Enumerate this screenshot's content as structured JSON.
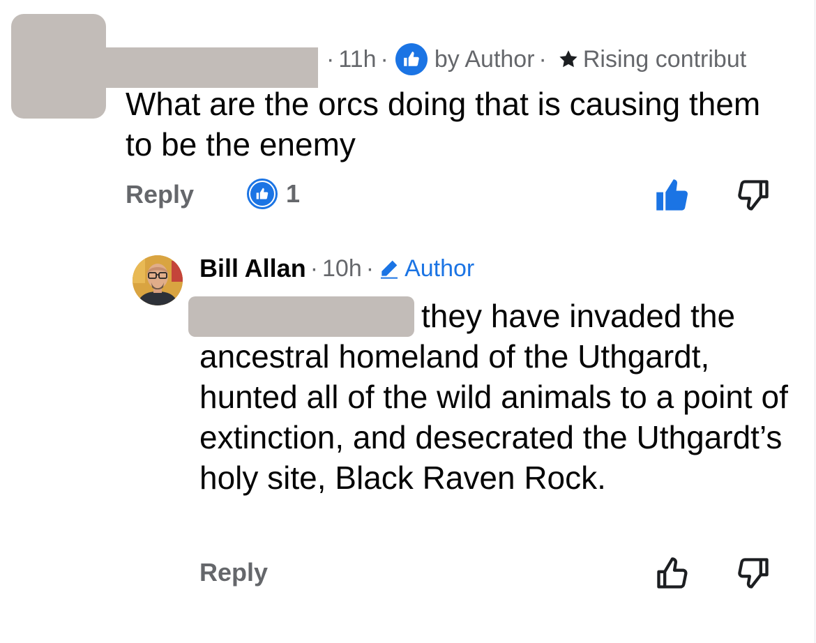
{
  "comment1": {
    "time": "11h",
    "dot": "·",
    "badge_text": "by Author",
    "rank": "Rising contribut",
    "text": "What are the orcs doing that is causing them to be the enemy",
    "reply_label": "Reply",
    "reaction_count": "1"
  },
  "comment2": {
    "author": "Bill Allan",
    "time": "10h",
    "dot": "·",
    "role": "Author",
    "text_first_line": "they have invaded the",
    "text_rest": "ancestral homeland of the Uthgardt, hunted all of the wild animals to a point of extinction, and desecrated the Uthgardt’s holy site, Black Raven Rock.",
    "reply_label": "Reply"
  },
  "colors": {
    "accent": "#1b74e4",
    "muted": "#65676b",
    "redaction": "#c2bcb8"
  },
  "icons": {
    "like_badge": "thumbs-up-icon",
    "star": "star-icon",
    "pencil": "pencil-icon",
    "upvote_filled": "thumbs-up-filled-icon",
    "upvote_outline": "thumbs-up-outline-icon",
    "downvote": "thumbs-down-outline-icon"
  }
}
